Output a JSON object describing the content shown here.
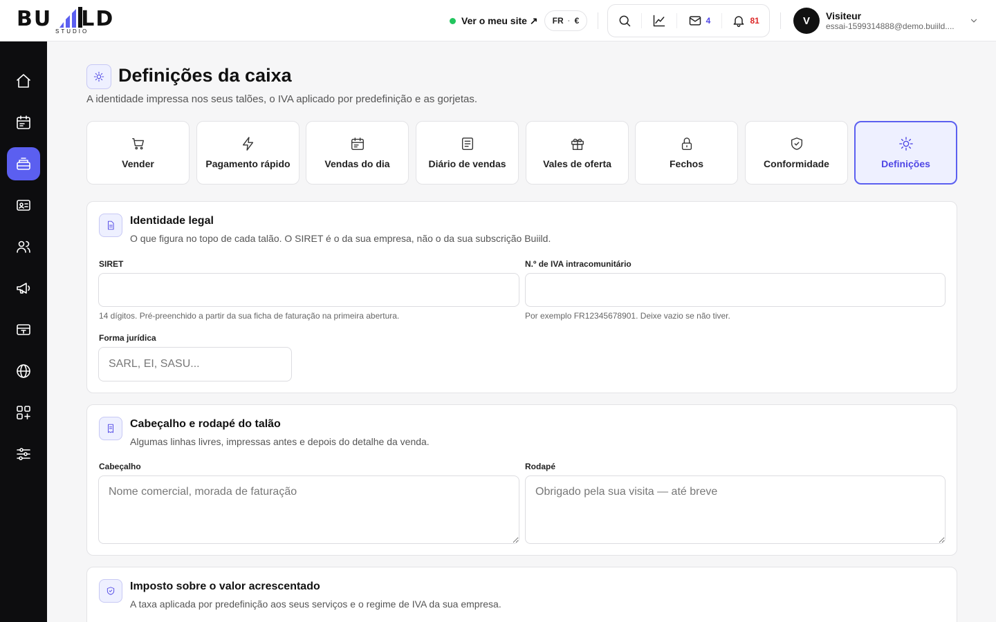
{
  "brand": {
    "logo_left": "BU",
    "logo_right": "LD",
    "logo_sub": "STUDIO"
  },
  "topbar": {
    "visit_label": "Ver o meu site ↗",
    "lang": "FR",
    "currency": "€",
    "lang_sep": "·",
    "messages_count": "4",
    "notifications_count": "81"
  },
  "user": {
    "initial": "V",
    "name": "Visiteur",
    "email": "essai-1599314888@demo.buiild...."
  },
  "page": {
    "title": "Definições da caixa",
    "subtitle": "A identidade impressa nos seus talões, o IVA aplicado por predefinição e as gorjetas."
  },
  "tabs": [
    {
      "label": "Vender",
      "icon": "cart-icon"
    },
    {
      "label": "Pagamento rápido",
      "icon": "lightning-icon"
    },
    {
      "label": "Vendas do dia",
      "icon": "calendar-icon"
    },
    {
      "label": "Diário de vendas",
      "icon": "journal-icon"
    },
    {
      "label": "Vales de oferta",
      "icon": "gift-icon"
    },
    {
      "label": "Fechos",
      "icon": "lock-icon"
    },
    {
      "label": "Conformidade",
      "icon": "shield-check-icon"
    },
    {
      "label": "Definições",
      "icon": "sun-gear-icon",
      "active": true
    }
  ],
  "identity": {
    "title": "Identidade legal",
    "subtitle": "O que figura no topo de cada talão. O SIRET é o da sua empresa, não o da sua subscrição Buiild.",
    "siret_label": "SIRET",
    "siret_value": "",
    "siret_help": "14 dígitos. Pré-preenchido a partir da sua ficha de faturação na primeira abertura.",
    "vat_label": "N.º de IVA intracomunitário",
    "vat_value": "",
    "vat_help": "Por exemplo FR12345678901. Deixe vazio se não tiver.",
    "legal_form_label": "Forma jurídica",
    "legal_form_placeholder": "SARL, EI, SASU..."
  },
  "receipt": {
    "title": "Cabeçalho e rodapé do talão",
    "subtitle": "Algumas linhas livres, impressas antes e depois do detalhe da venda.",
    "header_label": "Cabeçalho",
    "header_placeholder": "Nome comercial, morada de faturação",
    "footer_label": "Rodapé",
    "footer_placeholder": "Obrigado pela sua visita — até breve"
  },
  "vat": {
    "title": "Imposto sobre o valor acrescentado",
    "subtitle": "A taxa aplicada por predefinição aos seus serviços e o regime de IVA da sua empresa."
  },
  "colors": {
    "accent": "#5b5ff0",
    "sidebar": "#0d0d0f",
    "online": "#22c55e",
    "alert": "#dc2626"
  }
}
